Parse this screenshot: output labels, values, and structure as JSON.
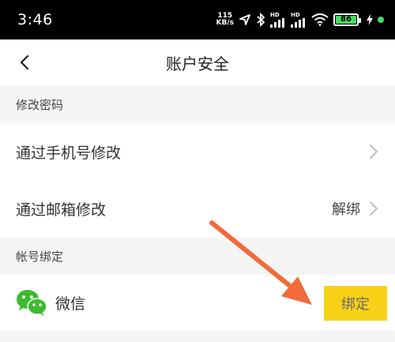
{
  "status": {
    "time": "3:46",
    "speed_value": "115",
    "speed_unit": "KB/s",
    "hd1": "HD",
    "hd2": "HD",
    "battery": "86"
  },
  "nav": {
    "title": "账户安全"
  },
  "sections": {
    "password_header": "修改密码",
    "binding_header": "帐号绑定"
  },
  "password_rows": {
    "phone_label": "通过手机号修改",
    "email_label": "通过邮箱修改",
    "email_value": "解绑"
  },
  "binding_rows": {
    "wechat_label": "微信",
    "wechat_button": "绑定"
  },
  "colors": {
    "accent_yellow": "#f7d117",
    "wechat_green": "#3dbb2f",
    "annotation_arrow": "#f26b3a"
  },
  "icons": {
    "back": "chevron-left-icon",
    "chevron": "chevron-right-icon",
    "wechat": "wechat-icon"
  }
}
